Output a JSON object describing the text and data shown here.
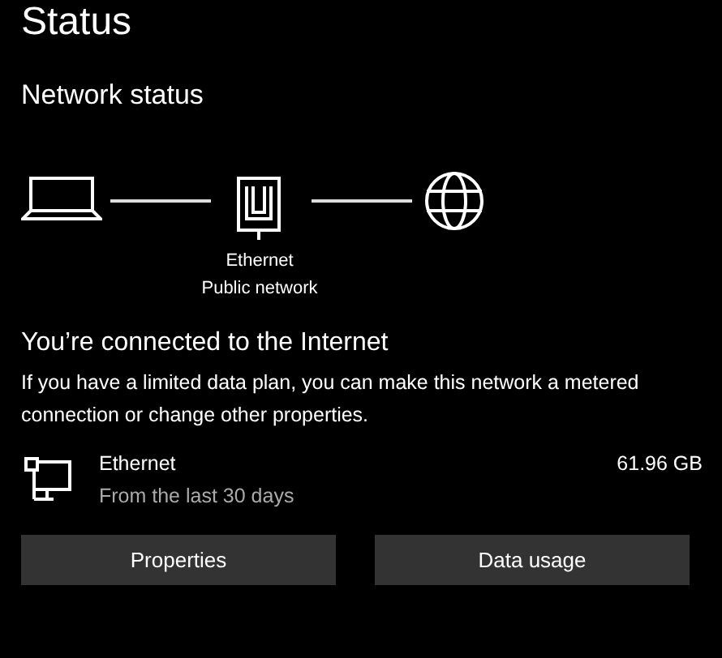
{
  "page_title": "Status",
  "section_title": "Network status",
  "diagram": {
    "adapter_name": "Ethernet",
    "network_profile": "Public network"
  },
  "connection_heading": "You’re connected to the Internet",
  "connection_text": "If you have a limited data plan, you can make this network a metered connection or change other properties.",
  "usage": {
    "name": "Ethernet",
    "period": "From the last 30 days",
    "amount": "61.96 GB"
  },
  "buttons": [
    "Properties",
    "Data usage"
  ]
}
